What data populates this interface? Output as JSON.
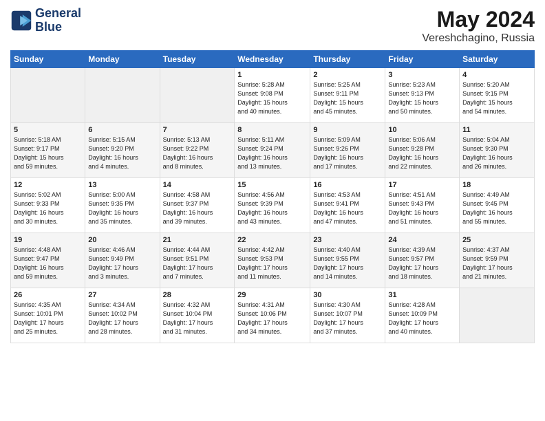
{
  "logo": {
    "line1": "General",
    "line2": "Blue"
  },
  "title": "May 2024",
  "subtitle": "Vereshchagino, Russia",
  "days_header": [
    "Sunday",
    "Monday",
    "Tuesday",
    "Wednesday",
    "Thursday",
    "Friday",
    "Saturday"
  ],
  "weeks": [
    [
      {
        "num": "",
        "info": ""
      },
      {
        "num": "",
        "info": ""
      },
      {
        "num": "",
        "info": ""
      },
      {
        "num": "1",
        "info": "Sunrise: 5:28 AM\nSunset: 9:08 PM\nDaylight: 15 hours\nand 40 minutes."
      },
      {
        "num": "2",
        "info": "Sunrise: 5:25 AM\nSunset: 9:11 PM\nDaylight: 15 hours\nand 45 minutes."
      },
      {
        "num": "3",
        "info": "Sunrise: 5:23 AM\nSunset: 9:13 PM\nDaylight: 15 hours\nand 50 minutes."
      },
      {
        "num": "4",
        "info": "Sunrise: 5:20 AM\nSunset: 9:15 PM\nDaylight: 15 hours\nand 54 minutes."
      }
    ],
    [
      {
        "num": "5",
        "info": "Sunrise: 5:18 AM\nSunset: 9:17 PM\nDaylight: 15 hours\nand 59 minutes."
      },
      {
        "num": "6",
        "info": "Sunrise: 5:15 AM\nSunset: 9:20 PM\nDaylight: 16 hours\nand 4 minutes."
      },
      {
        "num": "7",
        "info": "Sunrise: 5:13 AM\nSunset: 9:22 PM\nDaylight: 16 hours\nand 8 minutes."
      },
      {
        "num": "8",
        "info": "Sunrise: 5:11 AM\nSunset: 9:24 PM\nDaylight: 16 hours\nand 13 minutes."
      },
      {
        "num": "9",
        "info": "Sunrise: 5:09 AM\nSunset: 9:26 PM\nDaylight: 16 hours\nand 17 minutes."
      },
      {
        "num": "10",
        "info": "Sunrise: 5:06 AM\nSunset: 9:28 PM\nDaylight: 16 hours\nand 22 minutes."
      },
      {
        "num": "11",
        "info": "Sunrise: 5:04 AM\nSunset: 9:30 PM\nDaylight: 16 hours\nand 26 minutes."
      }
    ],
    [
      {
        "num": "12",
        "info": "Sunrise: 5:02 AM\nSunset: 9:33 PM\nDaylight: 16 hours\nand 30 minutes."
      },
      {
        "num": "13",
        "info": "Sunrise: 5:00 AM\nSunset: 9:35 PM\nDaylight: 16 hours\nand 35 minutes."
      },
      {
        "num": "14",
        "info": "Sunrise: 4:58 AM\nSunset: 9:37 PM\nDaylight: 16 hours\nand 39 minutes."
      },
      {
        "num": "15",
        "info": "Sunrise: 4:56 AM\nSunset: 9:39 PM\nDaylight: 16 hours\nand 43 minutes."
      },
      {
        "num": "16",
        "info": "Sunrise: 4:53 AM\nSunset: 9:41 PM\nDaylight: 16 hours\nand 47 minutes."
      },
      {
        "num": "17",
        "info": "Sunrise: 4:51 AM\nSunset: 9:43 PM\nDaylight: 16 hours\nand 51 minutes."
      },
      {
        "num": "18",
        "info": "Sunrise: 4:49 AM\nSunset: 9:45 PM\nDaylight: 16 hours\nand 55 minutes."
      }
    ],
    [
      {
        "num": "19",
        "info": "Sunrise: 4:48 AM\nSunset: 9:47 PM\nDaylight: 16 hours\nand 59 minutes."
      },
      {
        "num": "20",
        "info": "Sunrise: 4:46 AM\nSunset: 9:49 PM\nDaylight: 17 hours\nand 3 minutes."
      },
      {
        "num": "21",
        "info": "Sunrise: 4:44 AM\nSunset: 9:51 PM\nDaylight: 17 hours\nand 7 minutes."
      },
      {
        "num": "22",
        "info": "Sunrise: 4:42 AM\nSunset: 9:53 PM\nDaylight: 17 hours\nand 11 minutes."
      },
      {
        "num": "23",
        "info": "Sunrise: 4:40 AM\nSunset: 9:55 PM\nDaylight: 17 hours\nand 14 minutes."
      },
      {
        "num": "24",
        "info": "Sunrise: 4:39 AM\nSunset: 9:57 PM\nDaylight: 17 hours\nand 18 minutes."
      },
      {
        "num": "25",
        "info": "Sunrise: 4:37 AM\nSunset: 9:59 PM\nDaylight: 17 hours\nand 21 minutes."
      }
    ],
    [
      {
        "num": "26",
        "info": "Sunrise: 4:35 AM\nSunset: 10:01 PM\nDaylight: 17 hours\nand 25 minutes."
      },
      {
        "num": "27",
        "info": "Sunrise: 4:34 AM\nSunset: 10:02 PM\nDaylight: 17 hours\nand 28 minutes."
      },
      {
        "num": "28",
        "info": "Sunrise: 4:32 AM\nSunset: 10:04 PM\nDaylight: 17 hours\nand 31 minutes."
      },
      {
        "num": "29",
        "info": "Sunrise: 4:31 AM\nSunset: 10:06 PM\nDaylight: 17 hours\nand 34 minutes."
      },
      {
        "num": "30",
        "info": "Sunrise: 4:30 AM\nSunset: 10:07 PM\nDaylight: 17 hours\nand 37 minutes."
      },
      {
        "num": "31",
        "info": "Sunrise: 4:28 AM\nSunset: 10:09 PM\nDaylight: 17 hours\nand 40 minutes."
      },
      {
        "num": "",
        "info": ""
      }
    ]
  ]
}
